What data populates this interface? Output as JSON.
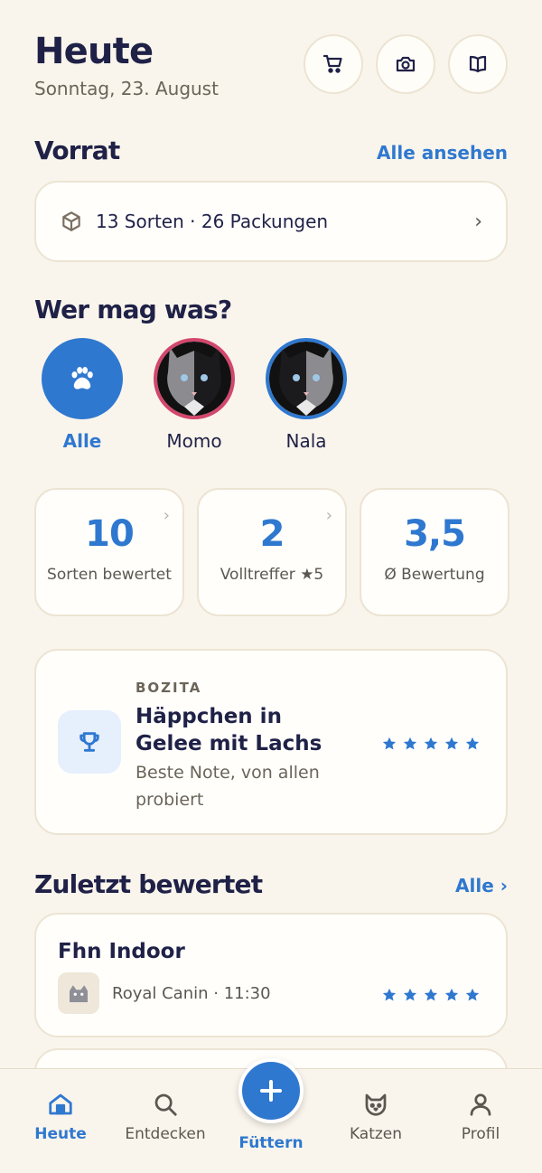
{
  "header": {
    "title": "Heute",
    "date": "Sonntag, 23. August"
  },
  "stock": {
    "heading": "Vorrat",
    "link": "Alle ansehen",
    "summary": "13 Sorten · 26 Packungen"
  },
  "cats": {
    "heading": "Wer mag was?",
    "items": [
      {
        "name": "Alle",
        "active": true
      },
      {
        "name": "Momo"
      },
      {
        "name": "Nala"
      }
    ]
  },
  "stats": [
    {
      "value": "10",
      "label": "Sorten bewertet"
    },
    {
      "value": "2",
      "label": "Volltreffer ★5"
    },
    {
      "value": "3,5",
      "label": "Ø Bewertung"
    }
  ],
  "highlight": {
    "brand": "BOZITA",
    "product": "Häppchen in Gelee mit Lachs",
    "subtitle": "Beste Note, von allen probiert",
    "rating": 5
  },
  "recent": {
    "heading": "Zuletzt bewertet",
    "link": "Alle ›",
    "items": [
      {
        "title": "Fhn Indoor",
        "meta": "Royal Canin · 11:30",
        "rating": 5
      }
    ]
  },
  "tabs": {
    "home": "Heute",
    "discover": "Entdecken",
    "feed": "Füttern",
    "cats": "Katzen",
    "profile": "Profil"
  },
  "colors": {
    "accent": "#2f78d0",
    "background": "#faf5ec",
    "ink": "#1f2147",
    "momo_ring": "#d2476d"
  }
}
